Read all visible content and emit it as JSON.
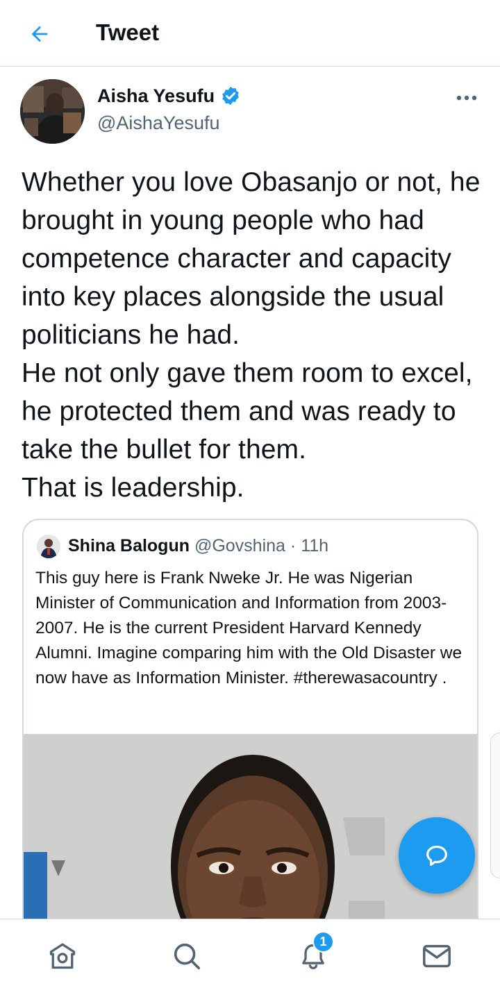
{
  "header": {
    "title": "Tweet",
    "back_icon": "arrow-left-icon"
  },
  "tweet": {
    "author_name": "Aisha Yesufu",
    "author_handle": "@AishaYesufu",
    "verified_icon": "verified-badge-icon",
    "more_icon": "more-horizontal-icon",
    "text": "Whether you love Obasanjo or not, he brought in young people who had competence character and capacity into key places alongside the usual politicians he had.\nHe not only gave them room to excel, he protected them and was ready to take the bullet for them.\nThat is leadership."
  },
  "quoted_tweet": {
    "author_name": "Shina Balogun",
    "author_handle": "@Govshina",
    "separator": "·",
    "time": "11h",
    "text": "This guy here is Frank Nweke Jr.  He was Nigerian Minister of Communication and Information from 2003-2007.  He is the current President Harvard Kennedy Alumni. Imagine comparing him with the Old Disaster we now have as Information Minister. #therewasacountry ."
  },
  "fab": {
    "icon": "reply-bubble-icon"
  },
  "bottom_nav": {
    "items": [
      {
        "icon": "home-icon"
      },
      {
        "icon": "search-icon"
      },
      {
        "icon": "notifications-bell-icon"
      },
      {
        "icon": "messages-envelope-icon"
      }
    ],
    "notification_badge": "1"
  },
  "colors": {
    "accent": "#1d9bf0",
    "text_primary": "#0f1419",
    "text_secondary": "#536471",
    "border": "#cfd9de"
  }
}
